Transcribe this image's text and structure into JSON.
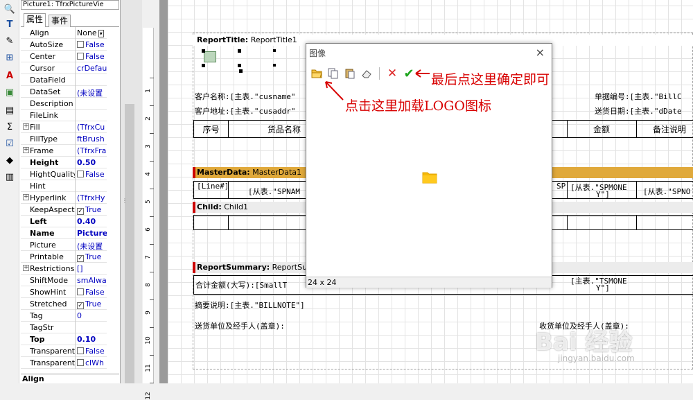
{
  "inspector": {
    "object_combo": "Picture1: TfrxPictureVie",
    "tabs": [
      "属性",
      "事件"
    ],
    "properties": [
      {
        "name": "Align",
        "value": "None",
        "bold": false,
        "expand": false,
        "check": null
      },
      {
        "name": "AutoSize",
        "value": "False",
        "bold": false,
        "expand": false,
        "check": false
      },
      {
        "name": "Center",
        "value": "False",
        "bold": false,
        "expand": false,
        "check": false
      },
      {
        "name": "Cursor",
        "value": "crDefau",
        "bold": false,
        "expand": false,
        "check": null
      },
      {
        "name": "DataField",
        "value": "",
        "bold": false,
        "expand": false,
        "check": null
      },
      {
        "name": "DataSet",
        "value": "(未设置",
        "bold": false,
        "expand": false,
        "check": null
      },
      {
        "name": "Description",
        "value": "",
        "bold": false,
        "expand": false,
        "check": null
      },
      {
        "name": "FileLink",
        "value": "",
        "bold": false,
        "expand": false,
        "check": null
      },
      {
        "name": "Fill",
        "value": "(TfrxCu",
        "bold": false,
        "expand": true,
        "check": null
      },
      {
        "name": "FillType",
        "value": "ftBrush",
        "bold": false,
        "expand": false,
        "check": null
      },
      {
        "name": "Frame",
        "value": "(TfrxFra",
        "bold": false,
        "expand": true,
        "check": null
      },
      {
        "name": "Height",
        "value": "0.50",
        "bold": true,
        "expand": false,
        "check": null
      },
      {
        "name": "HightQuality",
        "value": "False",
        "bold": false,
        "expand": false,
        "check": false
      },
      {
        "name": "Hint",
        "value": "",
        "bold": false,
        "expand": false,
        "check": null
      },
      {
        "name": "Hyperlink",
        "value": "(TfrxHy",
        "bold": false,
        "expand": true,
        "check": null
      },
      {
        "name": "KeepAspectR",
        "value": "True",
        "bold": false,
        "expand": false,
        "check": true
      },
      {
        "name": "Left",
        "value": "0.40",
        "bold": true,
        "expand": false,
        "check": null
      },
      {
        "name": "Name",
        "value": "Picture",
        "bold": true,
        "expand": false,
        "check": null
      },
      {
        "name": "Picture",
        "value": "(未设置",
        "bold": false,
        "expand": false,
        "check": null
      },
      {
        "name": "Printable",
        "value": "True",
        "bold": false,
        "expand": false,
        "check": true
      },
      {
        "name": "Restrictions",
        "value": "[]",
        "bold": false,
        "expand": true,
        "check": null
      },
      {
        "name": "ShiftMode",
        "value": "smAlwa",
        "bold": false,
        "expand": false,
        "check": null
      },
      {
        "name": "ShowHint",
        "value": "False",
        "bold": false,
        "expand": false,
        "check": false
      },
      {
        "name": "Stretched",
        "value": "True",
        "bold": false,
        "expand": false,
        "check": true
      },
      {
        "name": "Tag",
        "value": "0",
        "bold": false,
        "expand": false,
        "check": null
      },
      {
        "name": "TagStr",
        "value": "",
        "bold": false,
        "expand": false,
        "check": null
      },
      {
        "name": "Top",
        "value": "0.10",
        "bold": true,
        "expand": false,
        "check": null
      },
      {
        "name": "Transparent",
        "value": "False",
        "bold": false,
        "expand": false,
        "check": false
      },
      {
        "name": "TransparentC",
        "value": "clWh",
        "bold": false,
        "expand": false,
        "check": false
      }
    ],
    "footer": "Align"
  },
  "ruler": [
    "1",
    "2",
    "3",
    "4",
    "5",
    "6",
    "7",
    "8",
    "9",
    "10",
    "11",
    "12"
  ],
  "report": {
    "report_title": {
      "label": "ReportTitle:",
      "name": "ReportTitle1"
    },
    "customer_name": "客户名称:[主表.\"cusname\"",
    "customer_addr": "客户地址:[主表.\"cusaddr\"",
    "bill_no": "单据编号:[主表.\"BillC",
    "delivery_date": "送货日期:[主表.\"dDate",
    "headers": [
      "序号",
      "货品名称",
      "金额",
      "备注说明"
    ],
    "master_data": {
      "label": "MasterData:",
      "name": "MasterData1"
    },
    "line_no": "[Line#]",
    "spname": "[从表.\"SPNAM",
    "sp_short": "SP",
    "spmoney": "[从表.\"SPMONE",
    "spmoney_y": "Y\"]",
    "spno": "[从表.\"SPNO",
    "child": {
      "label": "Child:",
      "name": "Child1"
    },
    "report_summary": {
      "label": "ReportSummary:",
      "name": "ReportSu"
    },
    "total_caps": "合计金额(大写):[SmallT",
    "total_money": "[主表.\"TSMONE",
    "total_money_y": "Y\"]",
    "summary_note": "摘要说明:[主表.\"BILLNOTE\"]",
    "sender": "送货单位及经手人(盖章):",
    "receiver": "收货单位及经手人(盖章):"
  },
  "dialog": {
    "title": "图像",
    "close": "×",
    "status": "24 x 24",
    "toolbar": {
      "open_icon": "folder-open-icon",
      "copy_icon": "copy-icon",
      "paste_icon": "paste-icon",
      "clear_icon": "eraser-icon",
      "cancel_icon": "x-icon",
      "ok_icon": "checkmark-icon"
    }
  },
  "annotations": {
    "confirm": "最后点这里确定即可",
    "load_logo": "点击这里加载LOGO图标"
  },
  "watermark": {
    "main": "Bai 经验",
    "url": "jingyan.baidu.com"
  },
  "colors": {
    "master_band": "#e0a93b",
    "band_header": "#ececec",
    "annotation": "#d80000",
    "checkmark": "#1fa51f",
    "cancel": "#d22",
    "folder": "#f5b90a"
  }
}
